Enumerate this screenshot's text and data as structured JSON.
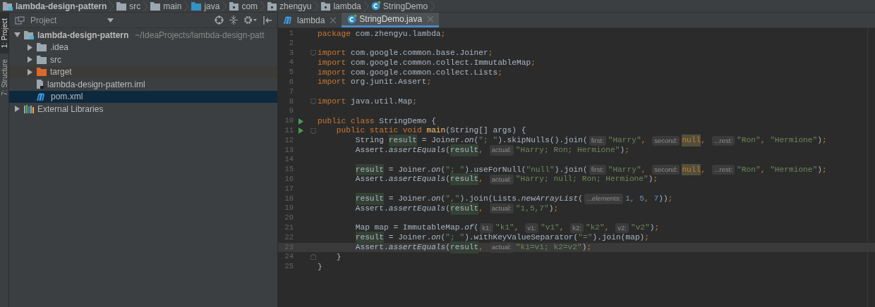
{
  "breadcrumbs": [
    {
      "kind": "module",
      "label": "lambda-design-pattern"
    },
    {
      "kind": "folder",
      "label": "src"
    },
    {
      "kind": "folder",
      "label": "main"
    },
    {
      "kind": "sources",
      "label": "java"
    },
    {
      "kind": "package",
      "label": "com"
    },
    {
      "kind": "package",
      "label": "zhengyu"
    },
    {
      "kind": "package",
      "label": "lambda"
    },
    {
      "kind": "class",
      "label": "StringDemo"
    }
  ],
  "tool_stripe": [
    {
      "label": "1: Project",
      "selected": true
    },
    {
      "label": "7: Structure",
      "selected": false
    }
  ],
  "project_panel": {
    "title": "Project",
    "tree": [
      {
        "label": "lambda-design-pattern",
        "path": "~/IdeaProjects/lambda-design-patt",
        "kind": "module",
        "expanded": true,
        "selected": false,
        "children": [
          {
            "label": ".idea",
            "kind": "folder",
            "expanded": false,
            "selected": false
          },
          {
            "label": "src",
            "kind": "folder",
            "expanded": false,
            "selected": false
          },
          {
            "label": "target",
            "kind": "excluded",
            "expanded": false,
            "selected": false
          },
          {
            "label": "lambda-design-pattern.iml",
            "kind": "file",
            "selected": false
          },
          {
            "label": "pom.xml",
            "kind": "maven",
            "selected": true
          }
        ]
      },
      {
        "label": "External Libraries",
        "kind": "library",
        "expanded": false,
        "selected": false
      }
    ]
  },
  "tabs": [
    {
      "label": "lambda",
      "kind": "maven",
      "selected": false
    },
    {
      "label": "StringDemo.java",
      "kind": "class",
      "selected": true
    }
  ],
  "editor": {
    "lines": [
      {
        "n": "1",
        "run": false,
        "fold_start": false,
        "fold_end": false,
        "current": false,
        "segments": [
          {
            "kind": "keyword",
            "text": "package"
          },
          {
            "kind": "plain",
            "text": " com.zhengyu.lambda"
          },
          {
            "kind": "keyword",
            "text": ";"
          }
        ]
      },
      {
        "n": "2",
        "run": false,
        "fold_start": false,
        "fold_end": false,
        "current": false
      },
      {
        "n": "3",
        "run": false,
        "fold_start": true,
        "fold_end": false,
        "current": false,
        "segments": [
          {
            "kind": "keyword",
            "text": "import"
          },
          {
            "kind": "plain",
            "text": " com.google.common.base.Joiner"
          },
          {
            "kind": "keyword",
            "text": ";"
          }
        ]
      },
      {
        "n": "4",
        "run": false,
        "fold_start": false,
        "fold_end": false,
        "current": false,
        "segments": [
          {
            "kind": "keyword",
            "text": "import"
          },
          {
            "kind": "plain",
            "text": " com.google.common.collect.ImmutableMap"
          },
          {
            "kind": "keyword",
            "text": ";"
          }
        ]
      },
      {
        "n": "5",
        "run": false,
        "fold_start": false,
        "fold_end": false,
        "current": false,
        "segments": [
          {
            "kind": "keyword",
            "text": "import"
          },
          {
            "kind": "plain",
            "text": " com.google.common.collect.Lists"
          },
          {
            "kind": "keyword",
            "text": ";"
          }
        ]
      },
      {
        "n": "6",
        "run": false,
        "fold_start": false,
        "fold_end": false,
        "current": false,
        "segments": [
          {
            "kind": "keyword",
            "text": "import"
          },
          {
            "kind": "plain",
            "text": " org.junit.Assert"
          },
          {
            "kind": "keyword",
            "text": ";"
          }
        ]
      },
      {
        "n": "7",
        "run": false,
        "fold_start": false,
        "fold_end": false,
        "current": false
      },
      {
        "n": "8",
        "run": false,
        "fold_start": true,
        "fold_end": false,
        "current": false,
        "segments": [
          {
            "kind": "keyword",
            "text": "import"
          },
          {
            "kind": "plain",
            "text": " java.util.Map"
          },
          {
            "kind": "keyword",
            "text": ";"
          }
        ]
      },
      {
        "n": "9",
        "run": false,
        "fold_start": false,
        "fold_end": false,
        "current": false
      },
      {
        "n": "10",
        "run": true,
        "fold_start": false,
        "fold_end": false,
        "current": false,
        "segments": [
          {
            "kind": "keyword",
            "text": "public class"
          },
          {
            "kind": "plain",
            "text": " StringDemo {"
          }
        ]
      },
      {
        "n": "11",
        "run": true,
        "fold_start": true,
        "fold_end": false,
        "current": false,
        "segments": [
          {
            "kind": "keyword",
            "text": "    public static void"
          },
          {
            "kind": "method",
            "text": " main"
          },
          {
            "kind": "plain",
            "text": "(String[] args) {"
          }
        ]
      },
      {
        "n": "12",
        "run": false,
        "fold_start": false,
        "fold_end": false,
        "current": false,
        "segments": [
          {
            "kind": "plain",
            "text": "        String "
          },
          {
            "kind": "variable",
            "text": "result"
          },
          {
            "kind": "plain",
            "text": " = Joiner."
          },
          {
            "kind": "italic",
            "text": "on"
          },
          {
            "kind": "plain",
            "text": "("
          },
          {
            "kind": "string",
            "text": "\"; \""
          },
          {
            "kind": "plain",
            "text": ").skipNulls().join("
          },
          {
            "kind": "hint",
            "text": "first:"
          },
          {
            "kind": "string",
            "text": "\"Harry\""
          },
          {
            "kind": "keyword",
            "text": ", "
          },
          {
            "kind": "hint",
            "text": "second:"
          },
          {
            "kind": "null",
            "text": "null"
          },
          {
            "kind": "keyword",
            "text": ", "
          },
          {
            "kind": "hint",
            "text": "...rest:"
          },
          {
            "kind": "string",
            "text": "\"Ron\""
          },
          {
            "kind": "keyword",
            "text": ", "
          },
          {
            "kind": "string",
            "text": "\"Hermione\""
          },
          {
            "kind": "plain",
            "text": ")"
          },
          {
            "kind": "keyword",
            "text": ";"
          }
        ]
      },
      {
        "n": "13",
        "run": false,
        "fold_start": false,
        "fold_end": false,
        "current": false,
        "segments": [
          {
            "kind": "plain",
            "text": "        Assert."
          },
          {
            "kind": "italic",
            "text": "assertEquals"
          },
          {
            "kind": "plain",
            "text": "("
          },
          {
            "kind": "variable",
            "text": "result"
          },
          {
            "kind": "keyword",
            "text": ", "
          },
          {
            "kind": "hint",
            "text": "actual:"
          },
          {
            "kind": "string",
            "text": "\"Harry; Ron; Hermione\""
          },
          {
            "kind": "plain",
            "text": ")"
          },
          {
            "kind": "keyword",
            "text": ";"
          }
        ]
      },
      {
        "n": "14",
        "run": false,
        "fold_start": false,
        "fold_end": false,
        "current": false
      },
      {
        "n": "15",
        "run": false,
        "fold_start": false,
        "fold_end": false,
        "current": false,
        "segments": [
          {
            "kind": "variable",
            "text": "result"
          },
          {
            "kind": "plain",
            "text": " = Joiner."
          },
          {
            "kind": "italic",
            "text": "on"
          },
          {
            "kind": "plain",
            "text": "("
          },
          {
            "kind": "string",
            "text": "\"; \""
          },
          {
            "kind": "plain",
            "text": ").useForNull("
          },
          {
            "kind": "string",
            "text": "\"null\""
          },
          {
            "kind": "plain",
            "text": ").join("
          },
          {
            "kind": "hint",
            "text": "first:"
          },
          {
            "kind": "string",
            "text": "\"Harry\""
          },
          {
            "kind": "keyword",
            "text": ", "
          },
          {
            "kind": "hint",
            "text": "second:"
          },
          {
            "kind": "null",
            "text": "null"
          },
          {
            "kind": "keyword",
            "text": ", "
          },
          {
            "kind": "hint",
            "text": "...rest:"
          },
          {
            "kind": "string",
            "text": "\"Ron\""
          },
          {
            "kind": "keyword",
            "text": ", "
          },
          {
            "kind": "string",
            "text": "\"Hermione\""
          },
          {
            "kind": "plain",
            "text": ")"
          },
          {
            "kind": "keyword",
            "text": ";"
          }
        ]
      },
      {
        "n": "16",
        "run": false,
        "fold_start": false,
        "fold_end": false,
        "current": false,
        "segments": [
          {
            "kind": "plain",
            "text": "        Assert."
          },
          {
            "kind": "italic",
            "text": "assertEquals"
          },
          {
            "kind": "plain",
            "text": "("
          },
          {
            "kind": "variable",
            "text": "result"
          },
          {
            "kind": "keyword",
            "text": ", "
          },
          {
            "kind": "hint",
            "text": "actual:"
          },
          {
            "kind": "string",
            "text": "\"Harry; null; Ron; Hermione\""
          },
          {
            "kind": "plain",
            "text": ")"
          },
          {
            "kind": "keyword",
            "text": ";"
          }
        ]
      },
      {
        "n": "17",
        "run": false,
        "fold_start": false,
        "fold_end": false,
        "current": false
      },
      {
        "n": "18",
        "run": false,
        "fold_start": false,
        "fold_end": false,
        "current": false,
        "segments": [
          {
            "kind": "variable",
            "text": "result"
          },
          {
            "kind": "plain",
            "text": " = Joiner."
          },
          {
            "kind": "italic",
            "text": "on"
          },
          {
            "kind": "plain",
            "text": "("
          },
          {
            "kind": "string",
            "text": "\",\""
          },
          {
            "kind": "plain",
            "text": ").join(Lists."
          },
          {
            "kind": "italic",
            "text": "newArrayList"
          },
          {
            "kind": "plain",
            "text": "("
          },
          {
            "kind": "hint",
            "text": "...elements:"
          },
          {
            "kind": "number",
            "text": "1"
          },
          {
            "kind": "keyword",
            "text": ", "
          },
          {
            "kind": "number",
            "text": "5"
          },
          {
            "kind": "keyword",
            "text": ", "
          },
          {
            "kind": "number",
            "text": "7"
          },
          {
            "kind": "plain",
            "text": "))"
          },
          {
            "kind": "keyword",
            "text": ";"
          }
        ]
      },
      {
        "n": "19",
        "run": false,
        "fold_start": false,
        "fold_end": false,
        "current": false,
        "segments": [
          {
            "kind": "plain",
            "text": "        Assert."
          },
          {
            "kind": "italic",
            "text": "assertEquals"
          },
          {
            "kind": "plain",
            "text": "("
          },
          {
            "kind": "variable",
            "text": "result"
          },
          {
            "kind": "keyword",
            "text": ", "
          },
          {
            "kind": "hint",
            "text": "actual:"
          },
          {
            "kind": "string",
            "text": "\"1,5,7\""
          },
          {
            "kind": "plain",
            "text": ")"
          },
          {
            "kind": "keyword",
            "text": ";"
          }
        ]
      },
      {
        "n": "20",
        "run": false,
        "fold_start": false,
        "fold_end": false,
        "current": false
      },
      {
        "n": "21",
        "run": false,
        "fold_start": false,
        "fold_end": false,
        "current": false,
        "segments": [
          {
            "kind": "plain",
            "text": "        Map map = ImmutableMap."
          },
          {
            "kind": "italic",
            "text": "of"
          },
          {
            "kind": "plain",
            "text": "("
          },
          {
            "kind": "hint",
            "text": "k1:"
          },
          {
            "kind": "string",
            "text": "\"k1\""
          },
          {
            "kind": "keyword",
            "text": ", "
          },
          {
            "kind": "hint",
            "text": "v1:"
          },
          {
            "kind": "string",
            "text": "\"v1\""
          },
          {
            "kind": "keyword",
            "text": ", "
          },
          {
            "kind": "hint",
            "text": "k2:"
          },
          {
            "kind": "string",
            "text": "\"k2\""
          },
          {
            "kind": "keyword",
            "text": ", "
          },
          {
            "kind": "hint",
            "text": "v2:"
          },
          {
            "kind": "string",
            "text": "\"v2\""
          },
          {
            "kind": "plain",
            "text": ")"
          },
          {
            "kind": "keyword",
            "text": ";"
          }
        ]
      },
      {
        "n": "22",
        "run": false,
        "fold_start": false,
        "fold_end": false,
        "current": false,
        "segments": [
          {
            "kind": "variable",
            "text": "result"
          },
          {
            "kind": "plain",
            "text": " = Joiner."
          },
          {
            "kind": "italic",
            "text": "on"
          },
          {
            "kind": "plain",
            "text": "("
          },
          {
            "kind": "string",
            "text": "\"; \""
          },
          {
            "kind": "plain",
            "text": ").withKeyValueSeparator("
          },
          {
            "kind": "string",
            "text": "\"=\""
          },
          {
            "kind": "plain",
            "text": ").join(map)"
          },
          {
            "kind": "keyword",
            "text": ";"
          }
        ]
      },
      {
        "n": "23",
        "run": false,
        "fold_start": false,
        "fold_end": false,
        "current": true,
        "segments": [
          {
            "kind": "plain",
            "text": "        Assert."
          },
          {
            "kind": "italic",
            "text": "assertEquals"
          },
          {
            "kind": "plain",
            "text": "("
          },
          {
            "kind": "variable",
            "text": "result"
          },
          {
            "kind": "keyword",
            "text": ", "
          },
          {
            "kind": "hint",
            "text": "actual:"
          },
          {
            "kind": "string",
            "text": "\"k1=v1; k2=v2\""
          },
          {
            "kind": "plain",
            "text": ")"
          },
          {
            "kind": "keyword",
            "text": ";"
          }
        ]
      },
      {
        "n": "24",
        "run": false,
        "fold_start": false,
        "fold_end": true,
        "current": false,
        "segments": [
          {
            "kind": "plain",
            "text": "    }"
          }
        ]
      },
      {
        "n": "25",
        "run": false,
        "fold_start": false,
        "fold_end": false,
        "current": false,
        "segments": [
          {
            "kind": "plain",
            "text": "}"
          }
        ]
      }
    ]
  }
}
